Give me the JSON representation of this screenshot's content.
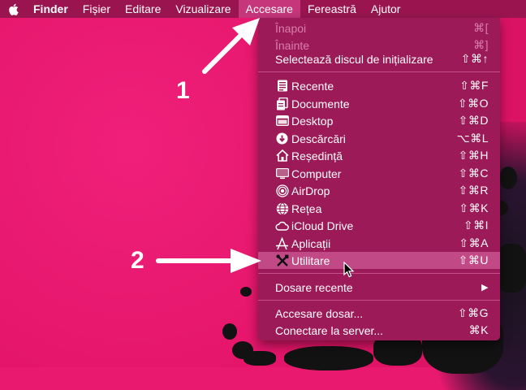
{
  "menubar": {
    "apple_icon": "apple-logo-icon",
    "items": [
      {
        "label": "Finder"
      },
      {
        "label": "Fișier"
      },
      {
        "label": "Editare"
      },
      {
        "label": "Vizualizare"
      },
      {
        "label": "Accesare"
      },
      {
        "label": "Fereastră"
      },
      {
        "label": "Ajutor"
      }
    ]
  },
  "menu": {
    "items": [
      {
        "label": "Înapoi",
        "shortcut": "⌘[",
        "enabled": false
      },
      {
        "label": "Înainte",
        "shortcut": "⌘]",
        "enabled": false
      },
      {
        "label": "Selectează discul de inițializare",
        "shortcut": "⇧⌘↑",
        "enabled": true
      },
      {
        "label": "Recente",
        "shortcut": "⇧⌘F",
        "icon": "recents-icon"
      },
      {
        "label": "Documente",
        "shortcut": "⇧⌘O",
        "icon": "documents-icon"
      },
      {
        "label": "Desktop",
        "shortcut": "⇧⌘D",
        "icon": "desktop-icon"
      },
      {
        "label": "Descărcări",
        "shortcut": "⌥⌘L",
        "icon": "downloads-icon"
      },
      {
        "label": "Reședință",
        "shortcut": "⇧⌘H",
        "icon": "home-icon"
      },
      {
        "label": "Computer",
        "shortcut": "⇧⌘C",
        "icon": "computer-icon"
      },
      {
        "label": "AirDrop",
        "shortcut": "⇧⌘R",
        "icon": "airdrop-icon"
      },
      {
        "label": "Rețea",
        "shortcut": "⇧⌘K",
        "icon": "network-icon"
      },
      {
        "label": "iCloud Drive",
        "shortcut": "⇧⌘I",
        "icon": "icloud-icon"
      },
      {
        "label": "Aplicații",
        "shortcut": "⇧⌘A",
        "icon": "applications-icon"
      },
      {
        "label": "Utilitare",
        "shortcut": "⇧⌘U",
        "icon": "utilities-icon",
        "highlighted": true
      },
      {
        "label": "Dosare recente",
        "submenu_arrow": "▶"
      },
      {
        "label": "Accesare dosar...",
        "shortcut": "⇧⌘G"
      },
      {
        "label": "Conectare la server...",
        "shortcut": "⌘K"
      }
    ]
  },
  "annotations": [
    {
      "label": "1"
    },
    {
      "label": "2"
    }
  ],
  "colors": {
    "desktop": "#e8196f",
    "menubar": "#9a1550",
    "menu": "#9c1a57",
    "highlight": "#c14a86"
  }
}
